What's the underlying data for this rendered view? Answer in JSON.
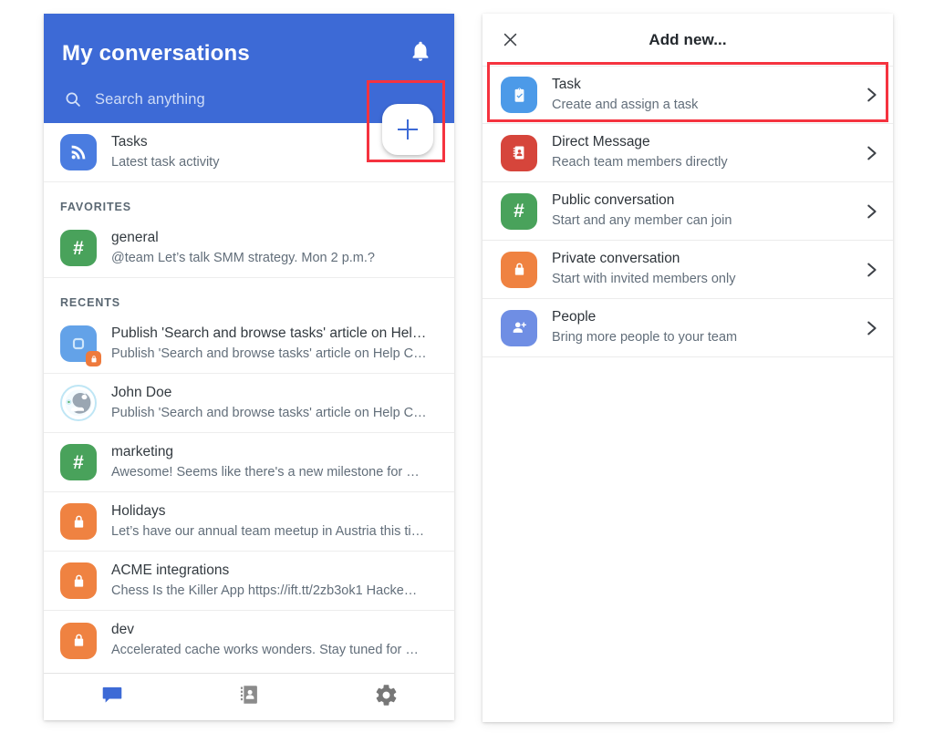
{
  "left_panel": {
    "header": {
      "title": "My conversations",
      "bell_icon": "bell-icon",
      "search_placeholder": "Search anything",
      "search_icon": "search-icon",
      "fab_icon": "plus-icon"
    },
    "tasks_row": {
      "title": "Tasks",
      "subtitle": "Latest task activity",
      "icon": "rss-icon",
      "color": "#4a7ce0"
    },
    "sections": [
      {
        "label": "FAVORITES",
        "items": [
          {
            "title": "general",
            "subtitle": "@team Let’s talk SMM strategy. Mon 2 p.m.?",
            "icon": "hash-icon",
            "color": "#49a25b",
            "badge": ""
          }
        ]
      },
      {
        "label": "RECENTS",
        "items": [
          {
            "title": "Publish 'Search and browse tasks' article on Hel…",
            "subtitle": "Publish 'Search and browse tasks' article on Help C…",
            "icon": "task-square-icon",
            "color": "#63a2e8",
            "badge": "lock-badge"
          },
          {
            "title": "John Doe",
            "subtitle": "Publish 'Search and browse tasks' article on Help C…",
            "icon": "avatar-robot",
            "color": "#b9e3f2",
            "badge": ""
          },
          {
            "title": "marketing",
            "subtitle": "Awesome! Seems like there's a new milestone for …",
            "icon": "hash-icon",
            "color": "#49a25b",
            "badge": ""
          },
          {
            "title": "Holidays",
            "subtitle": "Let’s have our annual team meetup in Austria this ti…",
            "icon": "lock-icon",
            "color": "#ef8241",
            "badge": ""
          },
          {
            "title": "ACME integrations",
            "subtitle": "Chess Is the Killer App https://ift.tt/2zb3ok1 Hacke…",
            "icon": "lock-icon",
            "color": "#ef8241",
            "badge": ""
          },
          {
            "title": "dev",
            "subtitle": "Accelerated cache works wonders. Stay tuned for …",
            "icon": "lock-icon",
            "color": "#ef8241",
            "badge": ""
          }
        ]
      }
    ],
    "bottom_nav": [
      {
        "name": "chat-tab",
        "icon": "chat-bubble-icon",
        "active": true
      },
      {
        "name": "contacts-tab",
        "icon": "contacts-book-icon",
        "active": false
      },
      {
        "name": "settings-tab",
        "icon": "gear-icon",
        "active": false
      }
    ]
  },
  "right_panel": {
    "title": "Add new...",
    "close_icon": "close-icon",
    "options": [
      {
        "title": "Task",
        "subtitle": "Create and assign a task",
        "icon": "clipboard-check-icon",
        "color": "#4c9ae8",
        "chevron": "chevron-right-icon"
      },
      {
        "title": "Direct Message",
        "subtitle": "Reach team members directly",
        "icon": "contact-card-icon",
        "color": "#d6453b",
        "chevron": "chevron-right-icon"
      },
      {
        "title": "Public conversation",
        "subtitle": "Start and any member can join",
        "icon": "hash-icon",
        "color": "#49a25b",
        "chevron": "chevron-right-icon"
      },
      {
        "title": "Private conversation",
        "subtitle": "Start with invited members only",
        "icon": "lock-icon",
        "color": "#ef8241",
        "chevron": "chevron-right-icon"
      },
      {
        "title": "People",
        "subtitle": "Bring more people to your team",
        "icon": "person-add-icon",
        "color": "#6f8ee4",
        "chevron": "chevron-right-icon"
      }
    ]
  },
  "annotations": {
    "color": "#f5333f",
    "boxes": [
      {
        "name": "fab-highlight",
        "target": "plus-fab"
      },
      {
        "name": "task-option-highlight",
        "target": "option-task"
      }
    ]
  },
  "theme": {
    "header_blue": "#3d6ad6",
    "accent_blue": "#4a7ce0",
    "green": "#49a25b",
    "orange": "#ef8241",
    "red": "#d6453b",
    "annotation_red": "#f5333f"
  }
}
